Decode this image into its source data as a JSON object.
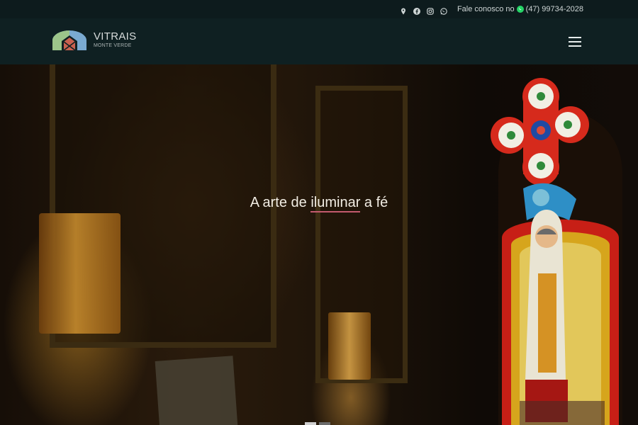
{
  "topbar": {
    "social_icons": [
      "map-pin-icon",
      "facebook-icon",
      "instagram-icon",
      "whatsapp-icon"
    ],
    "contact_prefix": "Fale conosco no",
    "contact_icon": "whatsapp-icon",
    "phone": "(47) 99734-2028"
  },
  "header": {
    "logo_title": "VITRAIS",
    "logo_subtitle": "MONTE VERDE",
    "menu_icon": "hamburger-menu-icon"
  },
  "hero": {
    "tagline_before": "A arte de ",
    "tagline_highlight": "iluminar",
    "tagline_after": " a fé"
  },
  "colors": {
    "topbar_bg": "#0d1b1d",
    "header_bg": "#0f2022",
    "accent_underline": "#c35a6e",
    "whatsapp_green": "#25d366"
  }
}
